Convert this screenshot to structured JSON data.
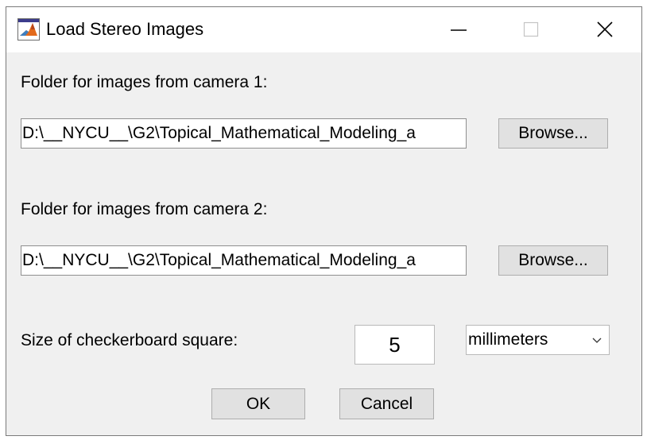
{
  "window": {
    "title": "Load Stereo Images",
    "icon": "matlab-icon"
  },
  "titlebar_controls": {
    "minimize": "minimize-icon",
    "maximize": "maximize-icon",
    "close": "close-icon"
  },
  "camera1": {
    "label": "Folder for images from camera 1:",
    "path": "D:\\__NYCU__\\G2\\Topical_Mathematical_Modeling_a",
    "browse_label": "Browse..."
  },
  "camera2": {
    "label": "Folder for images from camera 2:",
    "path": "D:\\__NYCU__\\G2\\Topical_Mathematical_Modeling_a",
    "browse_label": "Browse..."
  },
  "checkerboard": {
    "label": "Size of checkerboard square:",
    "value": "5",
    "unit_selected": "millimeters"
  },
  "actions": {
    "ok_label": "OK",
    "cancel_label": "Cancel"
  }
}
